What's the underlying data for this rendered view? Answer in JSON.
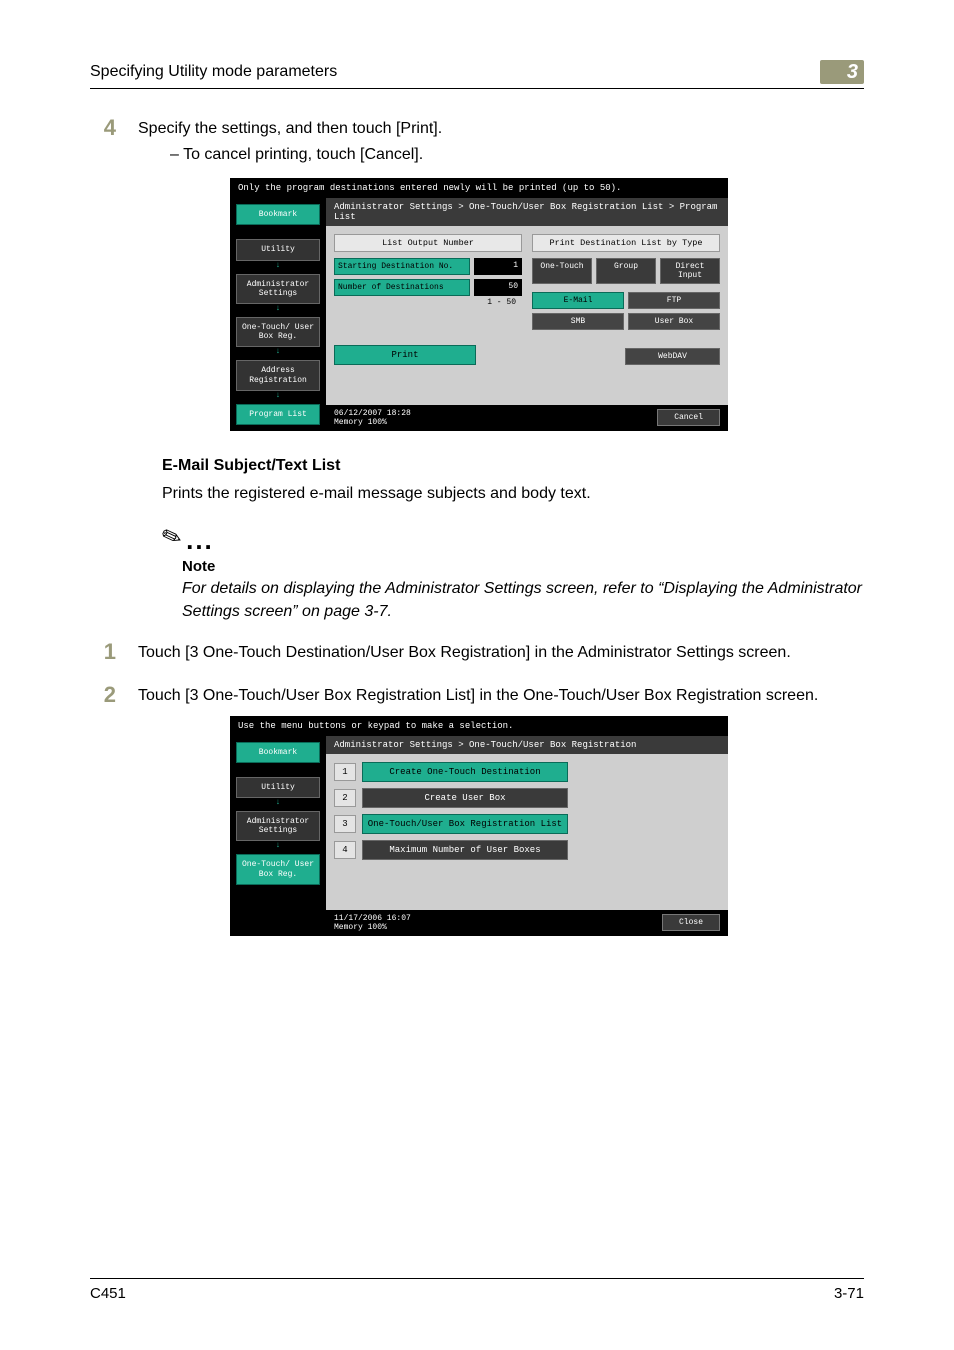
{
  "header": {
    "title": "Specifying Utility mode parameters",
    "chapter": "3"
  },
  "step4": {
    "num": "4",
    "text": "Specify the settings, and then touch [Print].",
    "sub": "To cancel printing, touch [Cancel]."
  },
  "ui1": {
    "top": "Only the program destinations entered newly will be printed (up to 50).",
    "bc": "Administrator Settings > One-Touch/User Box Registration List > Program List",
    "side": {
      "bookmark": "Bookmark",
      "utility": "Utility",
      "admin": "Administrator\nSettings",
      "onetouch": "One-Touch/\nUser Box Reg.",
      "address": "Address\nRegistration",
      "program": "Program List"
    },
    "left": {
      "colh": "List Output Number",
      "starting": "Starting\nDestination No.",
      "startv": "1",
      "numof": "Number of\nDestinations",
      "numv": "50",
      "range": "1 - 50",
      "print": "Print"
    },
    "right": {
      "colh": "Print Destination List by Type",
      "r1": [
        "One-Touch",
        "Group",
        "Direct\nInput"
      ],
      "r2": [
        "E-Mail",
        "FTP"
      ],
      "r3": [
        "SMB",
        "User Box"
      ],
      "r4": [
        "WebDAV"
      ]
    },
    "foot": {
      "dt": "06/12/2007   18:28",
      "mem": "Memory      100%",
      "cancel": "Cancel"
    }
  },
  "section": {
    "h": "E-Mail Subject/Text List",
    "p": "Prints the registered e-mail message subjects and body text."
  },
  "note": {
    "label": "Note",
    "text": "For details on displaying the Administrator Settings screen, refer to “Displaying the Administrator Settings screen” on page 3-7."
  },
  "step1": {
    "num": "1",
    "text": "Touch [3 One-Touch Destination/User Box Registration] in the Administrator Settings screen."
  },
  "step2": {
    "num": "2",
    "text": "Touch [3 One-Touch/User Box Registration List] in the One-Touch/User Box Registration screen."
  },
  "ui2": {
    "top": "Use the menu buttons or keypad to make a selection.",
    "bc": "Administrator Settings > One-Touch/User Box Registration",
    "side": {
      "bookmark": "Bookmark",
      "utility": "Utility",
      "admin": "Administrator\nSettings",
      "onetouch": "One-Touch/\nUser Box Reg."
    },
    "items": [
      {
        "n": "1",
        "l": "Create One-Touch\nDestination",
        "sel": true
      },
      {
        "n": "2",
        "l": "Create User Box"
      },
      {
        "n": "3",
        "l": "One-Touch/User Box\nRegistration List",
        "sel": true
      },
      {
        "n": "4",
        "l": "Maximum Number of User Boxes"
      }
    ],
    "foot": {
      "dt": "11/17/2006   16:07",
      "mem": "Memory      100%",
      "close": "Close"
    }
  },
  "footer": {
    "left": "C451",
    "right": "3-71"
  }
}
